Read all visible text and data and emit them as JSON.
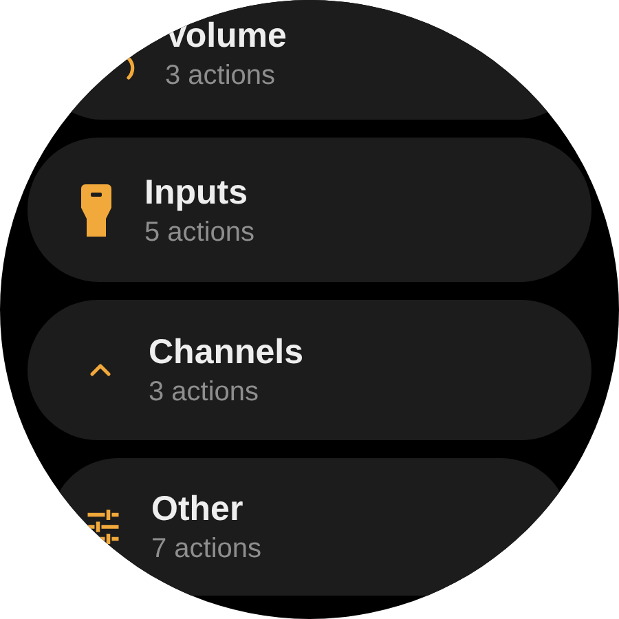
{
  "chips": [
    {
      "title": "Volume",
      "subtitle": "3 actions"
    },
    {
      "title": "Inputs",
      "subtitle": "5 actions"
    },
    {
      "title": "Channels",
      "subtitle": "3 actions"
    },
    {
      "title": "Other",
      "subtitle": "7 actions"
    }
  ]
}
